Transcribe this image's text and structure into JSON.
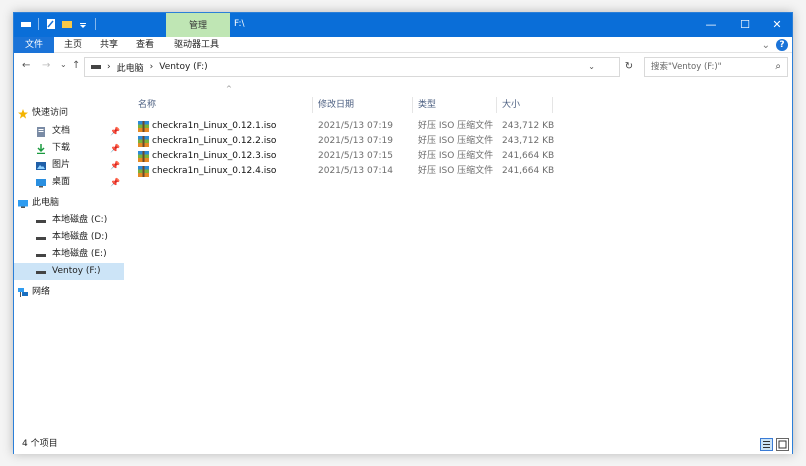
{
  "window": {
    "title": "F:\\",
    "manage_tab": "管理",
    "controls": {
      "minimize": "—",
      "maximize": "☐",
      "close": "✕"
    }
  },
  "ribbon": {
    "tabs": [
      "文件",
      "主页",
      "共享",
      "查看",
      "驱动器工具"
    ],
    "expand": "⌄",
    "help": "?"
  },
  "navigation": {
    "back": "←",
    "forward": "→",
    "recent": "⌄",
    "up": "↑",
    "breadcrumb": [
      "此电脑",
      "Ventoy (F:)"
    ],
    "separator": "›",
    "dropdown": "⌄",
    "refresh": "↻",
    "search_placeholder": "搜索\"Ventoy (F:)\""
  },
  "sidebar": {
    "quick_access": "快速访问",
    "quick_items": [
      "文档",
      "下载",
      "图片",
      "桌面"
    ],
    "this_pc": "此电脑",
    "drives": [
      "本地磁盘 (C:)",
      "本地磁盘 (D:)",
      "本地磁盘 (E:)",
      "Ventoy (F:)"
    ],
    "network": "网络",
    "pin_glyph": "📌"
  },
  "columns": {
    "name": "名称",
    "date": "修改日期",
    "type": "类型",
    "size": "大小",
    "sort_glyph": "^"
  },
  "files": [
    {
      "name": "checkra1n_Linux_0.12.1.iso",
      "date": "2021/5/13 07:19",
      "type": "好压 ISO 压缩文件",
      "size": "243,712 KB"
    },
    {
      "name": "checkra1n_Linux_0.12.2.iso",
      "date": "2021/5/13 07:19",
      "type": "好压 ISO 压缩文件",
      "size": "243,712 KB"
    },
    {
      "name": "checkra1n_Linux_0.12.3.iso",
      "date": "2021/5/13 07:15",
      "type": "好压 ISO 压缩文件",
      "size": "241,664 KB"
    },
    {
      "name": "checkra1n_Linux_0.12.4.iso",
      "date": "2021/5/13 07:14",
      "type": "好压 ISO 压缩文件",
      "size": "241,664 KB"
    }
  ],
  "status": {
    "item_count": "4 个项目"
  },
  "colors": {
    "titlebar": "#0a6ed8",
    "manage_tab": "#bfe6b4",
    "selected": "#cce4f7",
    "accent": "#1a73d8"
  },
  "icons": {
    "file": "archive-icon",
    "quick_access": "star-icon",
    "this_pc": "monitor-icon",
    "network": "network-icon",
    "drive": "drive-icon"
  }
}
